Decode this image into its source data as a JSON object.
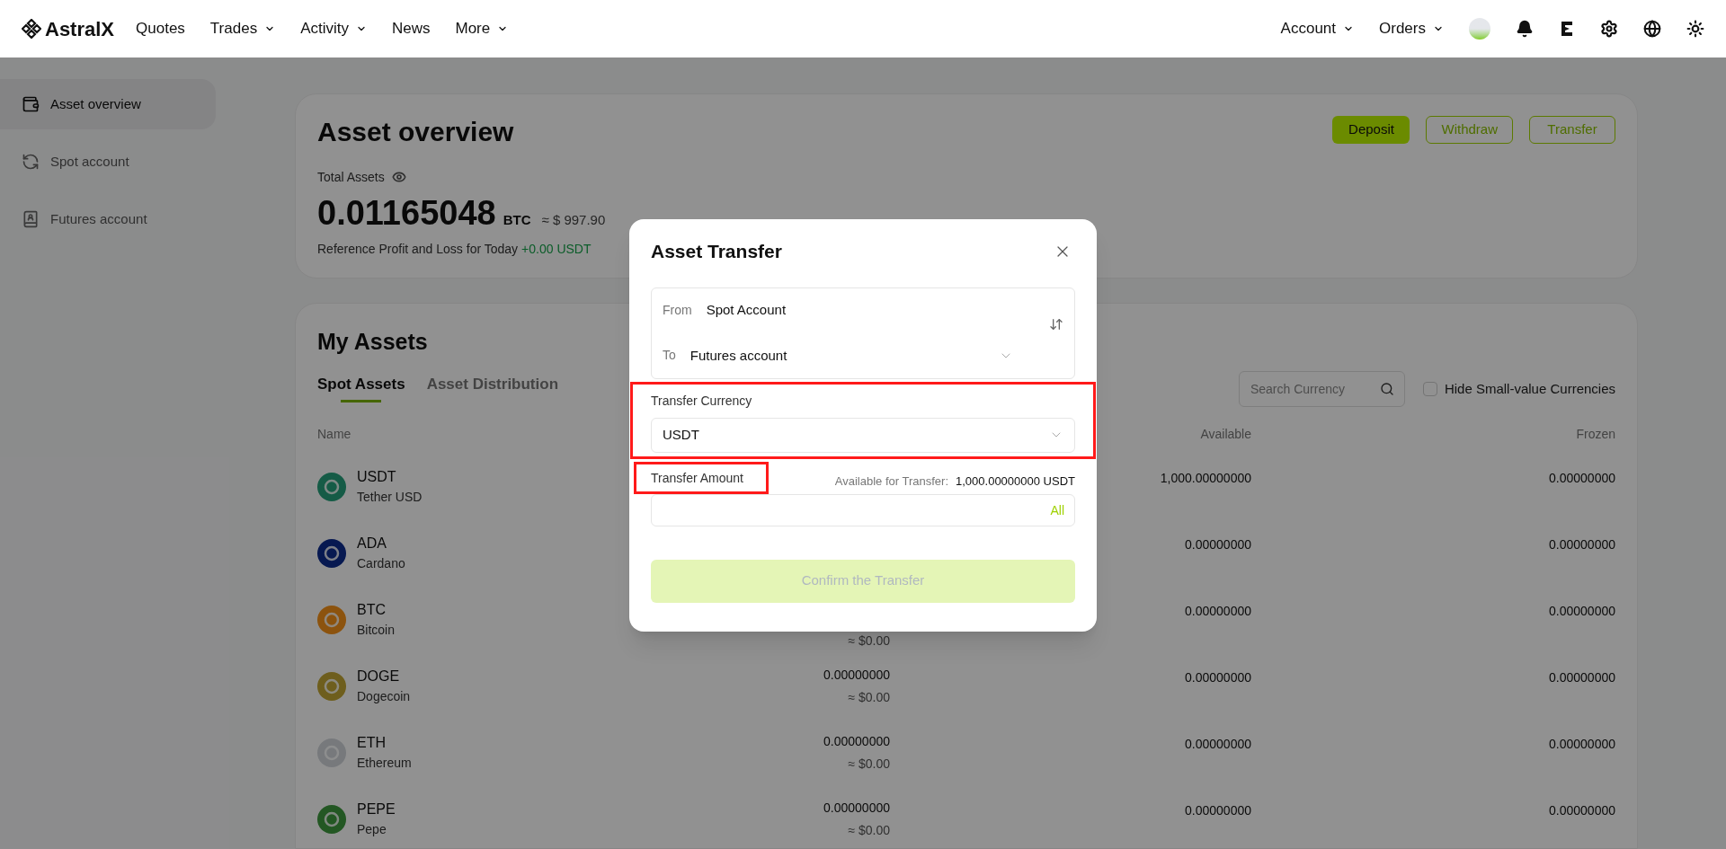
{
  "nav": {
    "logo": "AstralX",
    "items": [
      {
        "label": "Quotes",
        "dropdown": false
      },
      {
        "label": "Trades",
        "dropdown": true
      },
      {
        "label": "Activity",
        "dropdown": true
      },
      {
        "label": "News",
        "dropdown": false
      },
      {
        "label": "More",
        "dropdown": true
      }
    ],
    "right_items": [
      {
        "label": "Account",
        "dropdown": true
      },
      {
        "label": "Orders",
        "dropdown": true
      }
    ]
  },
  "sidebar": {
    "items": [
      {
        "label": "Asset overview",
        "selected": true
      },
      {
        "label": "Spot account",
        "selected": false
      },
      {
        "label": "Futures account",
        "selected": false
      }
    ]
  },
  "overview": {
    "title": "Asset overview",
    "total_label": "Total Assets",
    "amount": "0.01165048",
    "unit": "BTC",
    "approx": "≈ $ 997.90",
    "pnl_label": "Reference Profit and Loss for Today",
    "pnl_value": "+0.00 USDT",
    "buttons": [
      {
        "label": "Deposit",
        "kind": "primary"
      },
      {
        "label": "Withdraw",
        "kind": "outline"
      },
      {
        "label": "Transfer",
        "kind": "outline"
      }
    ]
  },
  "assets": {
    "title": "My Assets",
    "tabs": [
      {
        "label": "Spot Assets",
        "selected": true
      },
      {
        "label": "Asset Distribution",
        "selected": false
      }
    ],
    "search": {
      "placeholder": "Search Currency"
    },
    "hide_small": {
      "label": "Hide Small-value Currencies",
      "checked": false
    },
    "columns": {
      "name": "Name",
      "available": "Available",
      "frozen": "Frozen"
    },
    "rows": [
      {
        "symbol": "USDT",
        "name": "Tether USD",
        "available": "1,000.00000000",
        "frozen": "0.00000000"
      },
      {
        "symbol": "ADA",
        "name": "Cardano",
        "available": "0.00000000",
        "frozen": "0.00000000"
      },
      {
        "symbol": "BTC",
        "name": "Bitcoin",
        "total_usd": "≈ $0.00",
        "available": "0.00000000",
        "frozen": "0.00000000"
      },
      {
        "symbol": "DOGE",
        "name": "Dogecoin",
        "total": "0.00000000",
        "total_usd": "≈ $0.00",
        "available": "0.00000000",
        "frozen": "0.00000000"
      },
      {
        "symbol": "ETH",
        "name": "Ethereum",
        "total": "0.00000000",
        "total_usd": "≈ $0.00",
        "available": "0.00000000",
        "frozen": "0.00000000"
      },
      {
        "symbol": "PEPE",
        "name": "Pepe",
        "total": "0.00000000",
        "total_usd": "≈ $0.00",
        "available": "0.00000000",
        "frozen": "0.00000000"
      }
    ]
  },
  "dialog": {
    "title": "Asset Transfer",
    "from_label": "From",
    "from_value": "Spot Account",
    "to_label": "To",
    "to_value": "Futures account",
    "currency_label": "Transfer Currency",
    "currency_value": "USDT",
    "amount_label": "Transfer Amount",
    "available_label": "Available for Transfer:",
    "available_value": "1,000.00000000 USDT",
    "all_button": "All",
    "confirm": {
      "label": "Confirm the Transfer",
      "disabled": true
    }
  }
}
